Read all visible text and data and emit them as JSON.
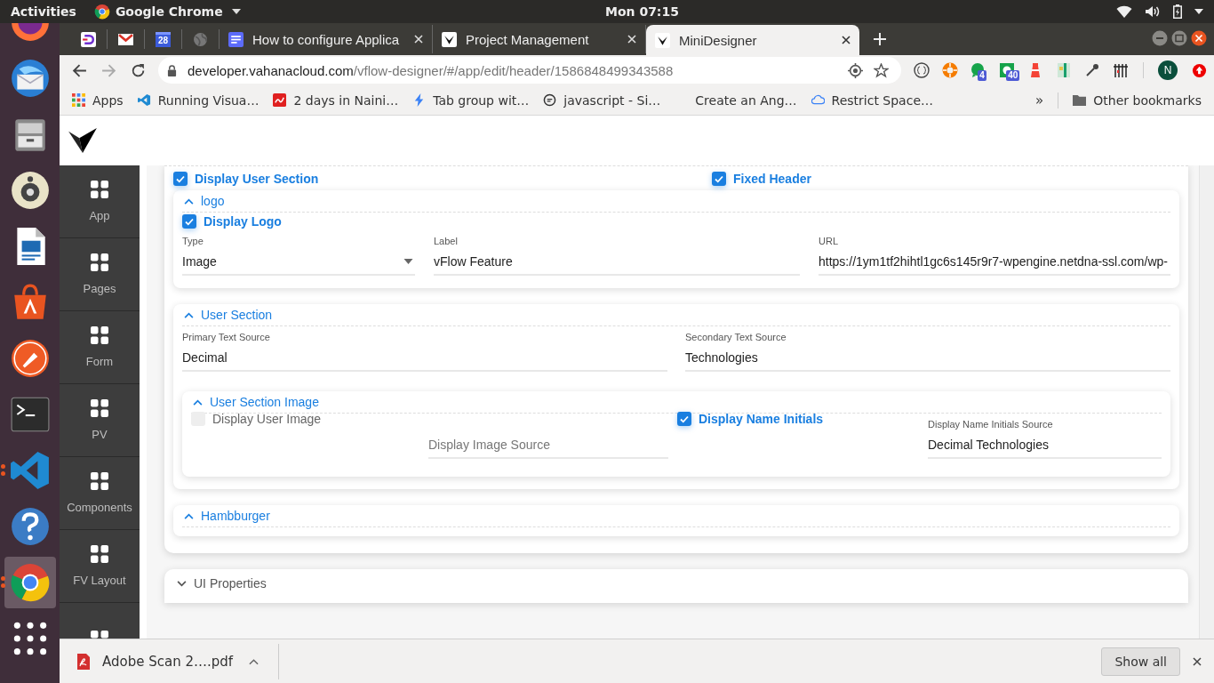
{
  "system_bar": {
    "activities": "Activities",
    "app_menu": "Google Chrome",
    "clock": "Mon 07:15"
  },
  "dock": [
    {
      "kind": "firefox",
      "selected": false,
      "running": false
    },
    {
      "kind": "mail",
      "selected": false,
      "running": false
    },
    {
      "kind": "files",
      "selected": false,
      "running": false
    },
    {
      "kind": "speaker",
      "selected": false,
      "running": false
    },
    {
      "kind": "writer",
      "selected": false,
      "running": false
    },
    {
      "kind": "store",
      "selected": false,
      "running": false
    },
    {
      "kind": "postman",
      "selected": false,
      "running": false
    },
    {
      "kind": "terminal",
      "selected": false,
      "running": false
    },
    {
      "kind": "code",
      "selected": false,
      "running": true
    },
    {
      "kind": "help",
      "selected": false,
      "running": false
    },
    {
      "kind": "chrome",
      "selected": true,
      "running": true
    },
    {
      "kind": "grid",
      "selected": false,
      "running": false
    }
  ],
  "tabs": [
    {
      "kind": "dash",
      "selected": false
    },
    {
      "kind": "mail",
      "selected": false
    },
    {
      "kind": "calendar",
      "badge": "28",
      "selected": false
    },
    {
      "kind": "globe",
      "selected": false
    },
    {
      "kind": "doc",
      "title": "How to configure Applica",
      "selected": false
    },
    {
      "kind": "logo",
      "title": "Project Management",
      "selected": false
    },
    {
      "kind": "logo",
      "title": "MiniDesigner",
      "selected": true
    }
  ],
  "address": {
    "domain": "developer.vahanacloud.com",
    "path": "/vflow-designer/#/app/edit/header/1586848499343588"
  },
  "extensions": [
    {
      "kind": "braces"
    },
    {
      "kind": "ring"
    },
    {
      "kind": "chat",
      "badge": "4"
    },
    {
      "kind": "square",
      "badge": "40"
    },
    {
      "kind": "tower"
    },
    {
      "kind": "map"
    },
    {
      "kind": "dropper"
    },
    {
      "kind": "bars"
    }
  ],
  "profile": {
    "initial": "N"
  },
  "bookmarks": [
    {
      "kind": "apps",
      "title": "Apps"
    },
    {
      "kind": "code",
      "title": "Running Visua…"
    },
    {
      "kind": "red",
      "title": "2 days in Naini…"
    },
    {
      "kind": "bolt",
      "title": "Tab group wit…"
    },
    {
      "kind": "search",
      "title": "javascript - Si…"
    },
    {
      "kind": "blank",
      "title": "Create an Ang…"
    },
    {
      "kind": "cloud",
      "title": "Restrict Space…"
    }
  ],
  "bookmark_overflow": "»",
  "other_bookmarks": "Other bookmarks",
  "sidebar": [
    {
      "kind": "grid",
      "label": "App"
    },
    {
      "kind": "grid",
      "label": "Pages"
    },
    {
      "kind": "grid",
      "label": "Form"
    },
    {
      "kind": "grid",
      "label": "PV"
    },
    {
      "kind": "grid",
      "label": "Components"
    },
    {
      "kind": "grid",
      "label": "FV Layout"
    },
    {
      "kind": "grid"
    }
  ],
  "options": [
    {
      "label": "Display User Section",
      "checked": true
    },
    {
      "label": "Fixed Header",
      "checked": true
    }
  ],
  "logo": {
    "title": "logo",
    "expanded": true,
    "display_logo": {
      "label": "Display Logo",
      "checked": true
    },
    "fields": [
      {
        "kind": "dropdown",
        "label": "Type",
        "value": "Image"
      },
      {
        "kind": "text",
        "label": "Label",
        "value": "vFlow Feature"
      },
      {
        "kind": "text",
        "label": "URL",
        "value": "https://1ym1tf2hihtl1gc6s145r9r7-wpengine.netdna-ssl.com/wp-"
      }
    ]
  },
  "user_section": {
    "title": "User Section",
    "expanded": true,
    "fields": [
      {
        "label": "Primary Text Source",
        "value": "Decimal"
      },
      {
        "label": "Secondary Text Source",
        "value": "Technologies"
      }
    ],
    "image": {
      "title": "User Section Image",
      "expanded": true,
      "items": [
        {
          "kind": "checkbox",
          "label": "Display User Image",
          "checked": false
        },
        {
          "kind": "field",
          "placeholder": "Display Image Source"
        },
        {
          "kind": "checkbox",
          "label": "Display Name Initials",
          "checked": true
        },
        {
          "kind": "field",
          "label": "Display Name Initials Source",
          "value": "Decimal Technologies"
        }
      ]
    }
  },
  "hamburger": {
    "title": "Hambburger",
    "expanded": true
  },
  "ui_properties": {
    "title": "UI Properties",
    "expanded": false
  },
  "downloads": {
    "file": "Adobe Scan 2….pdf",
    "show_all": "Show all"
  }
}
